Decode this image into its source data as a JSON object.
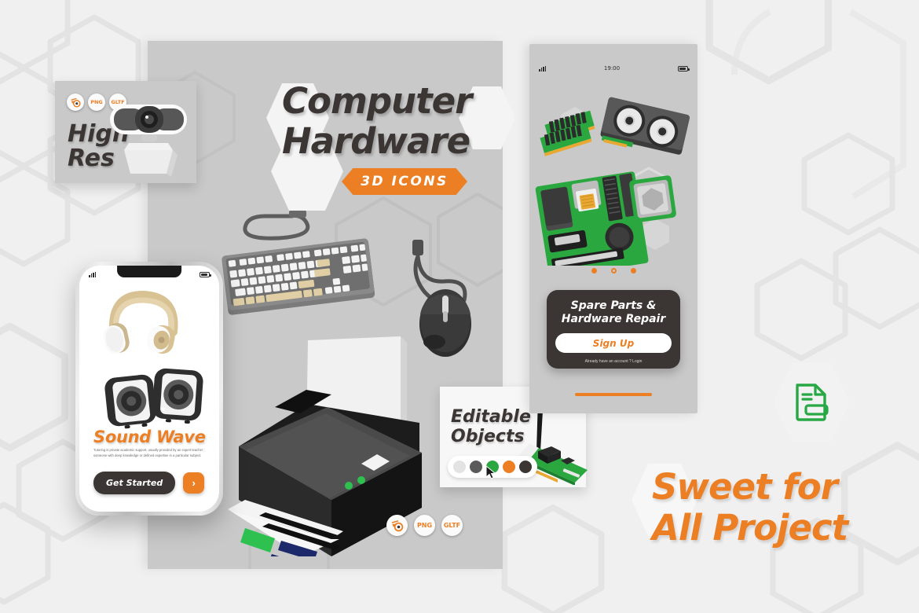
{
  "meta": {
    "theme_colors": {
      "background": "#f0f0f0",
      "panel": "#c9c9c9",
      "accent_orange": "#ec7f23",
      "dark": "#3b3633",
      "green": "#27a844",
      "white": "#ffffff"
    }
  },
  "headline": {
    "line1": "Computer",
    "line2": "Hardware",
    "badge": "3D ICONS"
  },
  "high_res_card": {
    "title_line1": "High",
    "title_line2": "Res",
    "formats": [
      {
        "name": "blender-icon",
        "label": ""
      },
      {
        "name": "png-badge",
        "label": "PNG"
      },
      {
        "name": "gltf-badge",
        "label": "GLTF"
      }
    ],
    "illustration": "webcam-3d-icon"
  },
  "editable_card": {
    "title_line1": "Editable",
    "title_line2": "Objects",
    "swatches": [
      "#e3e3e3",
      "#5a5a5a",
      "#2aa83f",
      "#ec7f23",
      "#3b3633"
    ],
    "selected_swatch_index": 2,
    "illustration": "network-card-3d-icon"
  },
  "phone_left": {
    "status": {
      "time": "",
      "signal": "signal-icon",
      "battery": "battery-icon"
    },
    "illustrations": [
      "headphones-3d-icon",
      "speakers-3d-icon"
    ],
    "title": "Sound Wave",
    "body": "Tutoring is private academic support, usually provided by an expert teacher ; someone with deep knowledge or defined expertise in a particular subject.",
    "primary_button": "Get Started",
    "next_button": "›"
  },
  "phone_right": {
    "status": {
      "time": "19:00",
      "signal": "signal-icon",
      "battery": "battery-icon"
    },
    "illustrations": [
      "ram-sticks-3d-icon",
      "graphics-card-3d-icon",
      "motherboard-3d-icon",
      "cpu-chip-3d-icon"
    ],
    "pagination": {
      "count": 3,
      "active_indexes": [
        0,
        2
      ]
    },
    "cta_title_line1": "Spare Parts &",
    "cta_title_line2": "Hardware Repair",
    "cta_button": "Sign Up",
    "cta_subtext": "Already have an account ? Login"
  },
  "center_illustrations": [
    "keyboard-3d-icon",
    "mouse-3d-icon",
    "printer-3d-icon"
  ],
  "format_badges": [
    {
      "name": "blender-icon",
      "label": ""
    },
    {
      "name": "png-badge",
      "label": "PNG"
    },
    {
      "name": "gltf-badge",
      "label": "GLTF"
    }
  ],
  "slogan": {
    "line1": "Sweet for",
    "line2": "All Project"
  },
  "doc_icon": {
    "name": "file-document-icon",
    "color": "#27a844"
  }
}
